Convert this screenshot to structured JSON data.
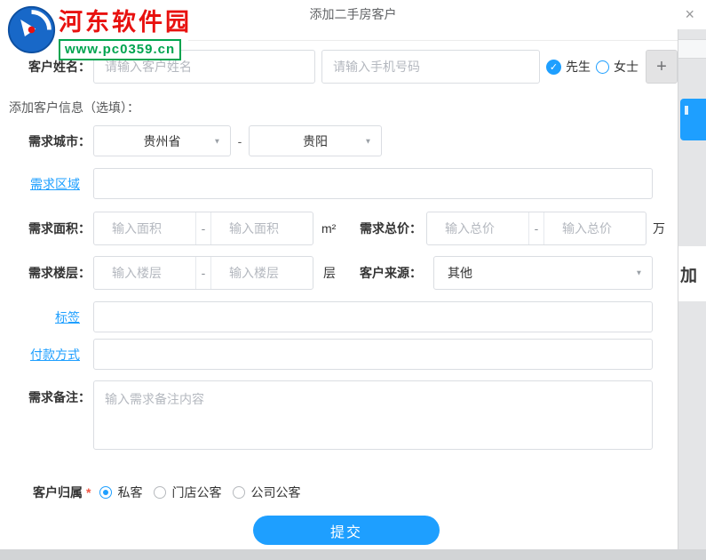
{
  "dialog": {
    "title": "添加二手房客户"
  },
  "icons": {
    "close": "×",
    "caret": "▼",
    "check": "✓",
    "plus": "+"
  },
  "watermark": {
    "site_name": "河东软件园",
    "site_url": "www.pc0359.cn"
  },
  "form": {
    "name_row": {
      "label": "客户姓名：",
      "name_placeholder": "请输入客户姓名",
      "phone_placeholder": "请输入手机号码",
      "gender": {
        "male": "先生",
        "female": "女士",
        "selected": "先生"
      }
    },
    "section_title": "添加客户信息（选填）：",
    "city_row": {
      "label": "需求城市：",
      "province": "贵州省",
      "separator": "-",
      "city": "贵阳"
    },
    "region_row": {
      "label": "需求区域",
      "value": ""
    },
    "area_row": {
      "label": "需求面积：",
      "min_placeholder": "输入面积",
      "max_placeholder": "输入面积",
      "separator": "-",
      "unit": "m²"
    },
    "price_row": {
      "label": "需求总价：",
      "min_placeholder": "输入总价",
      "max_placeholder": "输入总价",
      "separator": "-",
      "unit": "万"
    },
    "floor_row": {
      "label": "需求楼层：",
      "min_placeholder": "输入楼层",
      "max_placeholder": "输入楼层",
      "separator": "-",
      "unit": "层"
    },
    "source_row": {
      "label": "客户来源：",
      "value": "其他"
    },
    "tag_row": {
      "label": "标签",
      "value": ""
    },
    "payment_row": {
      "label": "付款方式",
      "value": ""
    },
    "remark_row": {
      "label": "需求备注：",
      "placeholder": "输入需求备注内容"
    },
    "ownership_row": {
      "label": "客户归属",
      "required_mark": "*",
      "options": [
        "私客",
        "门店公客",
        "公司公客"
      ],
      "selected": "私客"
    },
    "submit_label": "提交"
  },
  "background": {
    "fragment_text": "加"
  },
  "colors": {
    "accent": "#1e9fff",
    "link": "#1e9fff",
    "logo_red": "#e8110f",
    "logo_green": "#00a44f",
    "required": "#f25643"
  }
}
